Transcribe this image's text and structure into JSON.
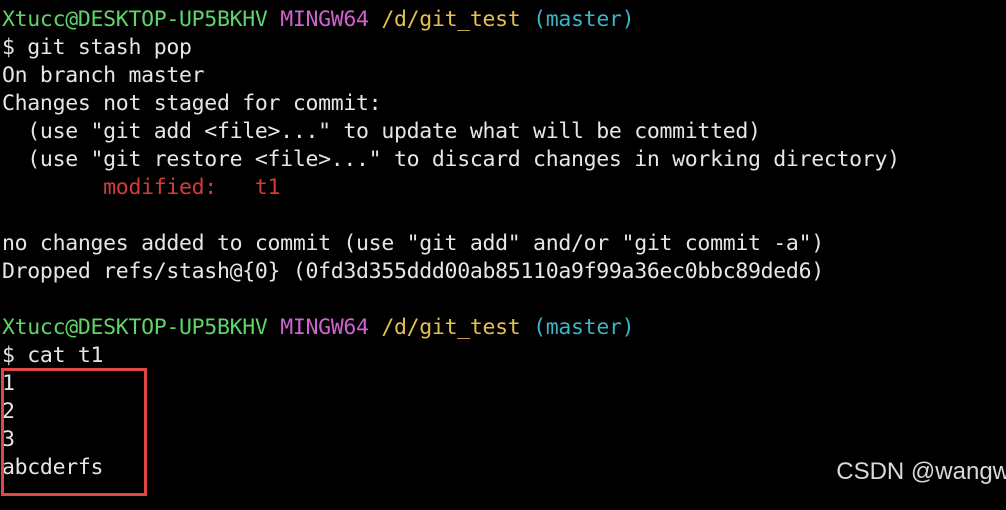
{
  "terminal": {
    "prompt1": {
      "user": "Xtucc@DESKTOP-UP5BKHV",
      "env": "MINGW64",
      "path": "/d/git_test",
      "branch": "(master)"
    },
    "cmd1": "$ git stash pop",
    "out1": "On branch master",
    "out2": "Changes not staged for commit:",
    "out3": "  (use \"git add <file>...\" to update what will be committed)",
    "out4": "  (use \"git restore <file>...\" to discard changes in working directory)",
    "modified_label": "        modified:   t1",
    "out5": "no changes added to commit (use \"git add\" and/or \"git commit -a\")",
    "out6": "Dropped refs/stash@{0} (0fd3d355ddd00ab85110a9f99a36ec0bbc89ded6)",
    "prompt2": {
      "user": "Xtucc@DESKTOP-UP5BKHV",
      "env": "MINGW64",
      "path": "/d/git_test",
      "branch": "(master)"
    },
    "cmd2": "$ cat t1",
    "file_lines": [
      "1",
      "2",
      "3",
      "abcderfs"
    ]
  },
  "watermark": "CSDN @wangw",
  "colors": {
    "background": "#000000",
    "user": "#5fd46b",
    "env": "#d062d0",
    "path": "#e5c14a",
    "branch": "#38b6c8",
    "modified": "#d43a3a",
    "highlight_box": "#e04747"
  }
}
